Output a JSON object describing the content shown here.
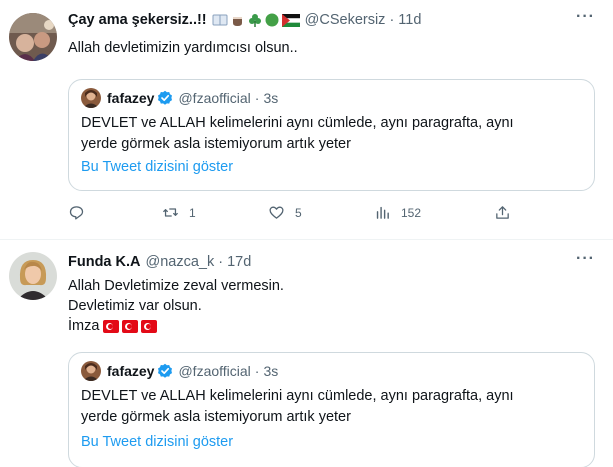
{
  "tweets": [
    {
      "author_name": "Çay ama şekersiz..!!",
      "author_emojis": [
        "book-emoji",
        "coffee-emoji",
        "shamrock-emoji",
        "green-circle-emoji",
        "palestine-flag-emoji"
      ],
      "handle": "@CSekersiz",
      "separator": "·",
      "time": "11d",
      "more": "···",
      "text_lines": [
        "Allah devletimizin yardımcısı olsun.."
      ],
      "quote": {
        "author_name": "fafazey",
        "handle": "@fzaofficial",
        "separator": "·",
        "time": "3s",
        "text_lines": [
          "DEVLET ve ALLAH kelimelerini aynı cümlede, aynı paragrafta, aynı",
          "yerde görmek asla istemiyorum artık yeter"
        ],
        "link": "Bu Tweet dizisini göster"
      },
      "actions": {
        "reply_count": "",
        "retweet_count": "1",
        "like_count": "5",
        "views_count": "152"
      }
    },
    {
      "author_name": "Funda K.A",
      "handle": "@nazca_k",
      "separator": "·",
      "time": "17d",
      "more": "···",
      "text_lines": [
        "Allah Devletimize zeval vermesin.",
        "Devletimiz var olsun.",
        "İmza"
      ],
      "flags": [
        "turkey-flag-emoji",
        "turkey-flag-emoji",
        "turkey-flag-emoji"
      ],
      "quote": {
        "author_name": "fafazey",
        "handle": "@fzaofficial",
        "separator": "·",
        "time": "3s",
        "text_lines": [
          "DEVLET ve ALLAH kelimelerini aynı cümlede, aynı paragrafta, aynı",
          "yerde görmek asla istemiyorum artık yeter"
        ],
        "link": "Bu Tweet dizisini göster"
      }
    }
  ],
  "colors": {
    "text": "#0f1419",
    "secondary": "#536471",
    "link": "#1d9bf0",
    "verified": "#1d9bf0",
    "border": "#cfd9de",
    "turkey_red": "#e30a17"
  }
}
